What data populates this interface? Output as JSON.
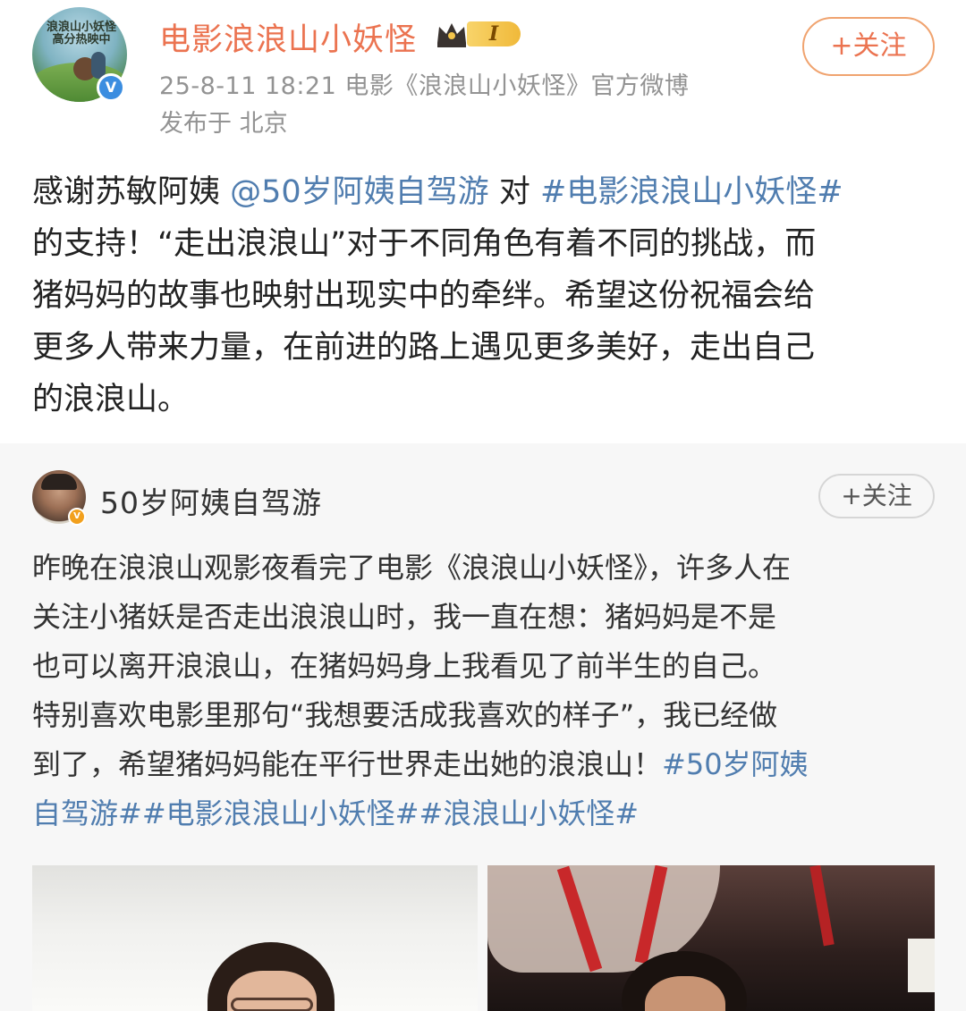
{
  "main_post": {
    "avatar_text": "浪浪山小妖怪 高分热映中",
    "author": "电影浪浪山小妖怪",
    "level": "I",
    "follow_label": "+关注",
    "meta": "25-8-11 18:21  电影《浪浪山小妖怪》官方微博",
    "location": "发布于 北京",
    "body": {
      "t1": "感谢苏敏阿姨 ",
      "mention": "@50岁阿姨自驾游",
      "t2": " 对 ",
      "topic": "#电影浪浪山小妖怪#",
      "t3": "\n的支持！“走出浪浪山”对于不同角色有着不同的挑战，而\n猪妈妈的故事也映射出现实中的牵绊。希望这份祝福会给\n更多人带来力量，在前进的路上遇见更多美好，走出自己\n的浪浪山。"
    }
  },
  "repost": {
    "author": "50岁阿姨自驾游",
    "follow_label": "+关注",
    "body": {
      "t1": "昨晚在浪浪山观影夜看完了电影《浪浪山小妖怪》，许多人在\n关注小猪妖是否走出浪浪山时，我一直在想：猪妈妈是不是\n也可以离开浪浪山，在猪妈妈身上我看见了前半生的自己。\n特别喜欢电影里那句“我想要活成我喜欢的样子”，我已经做\n到了，希望猪妈妈能在平行世界走出她的浪浪山！",
      "topic1": "#50岁阿姨\n自驾游#",
      "topic2": "#电影浪浪山小妖怪#",
      "topic3": "#浪浪山小妖怪#"
    }
  },
  "icons": {
    "verified_main": "verified-blue-icon",
    "verified_repost": "verified-orange-icon",
    "crown": "crown-icon"
  },
  "colors": {
    "author_name": "#eb7350",
    "link": "#507daf",
    "meta": "#939393",
    "repost_bg": "#f7f7f7"
  }
}
